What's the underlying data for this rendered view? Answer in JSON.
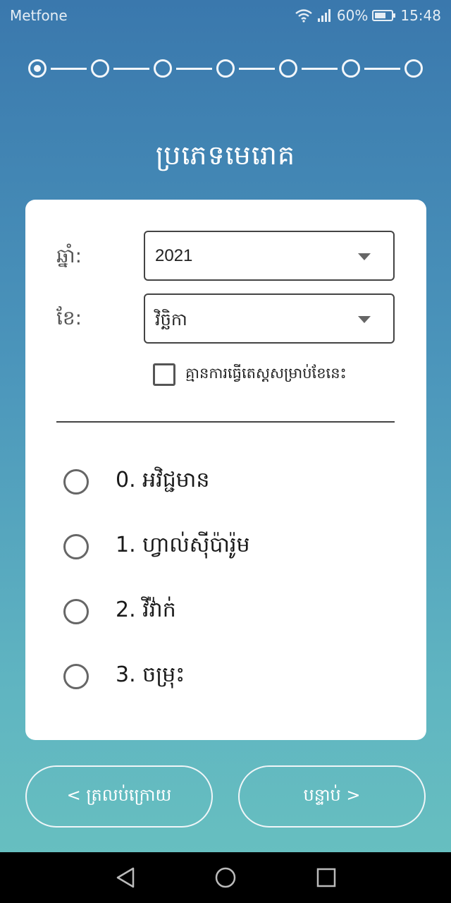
{
  "status_bar": {
    "carrier": "Metfone",
    "battery_percent": "60%",
    "time": "15:48",
    "icons": [
      "wifi-icon",
      "signal-icon",
      "battery-icon"
    ]
  },
  "stepper": {
    "total_steps": 7,
    "current_step": 1
  },
  "page": {
    "title": "ប្រភេទមេរោគ"
  },
  "form": {
    "year": {
      "label": "ឆ្នាំ:",
      "value": "2021"
    },
    "month": {
      "label": "ខែ:",
      "value": "វិច្ឆិកា"
    },
    "no_test_checkbox": {
      "label": "គ្មានការធ្វើតេស្តសម្រាប់ខែនេះ",
      "checked": false
    }
  },
  "options": [
    {
      "label": "0. អវិជ្ជមាន",
      "selected": false
    },
    {
      "label": "1. ហ្វាល់ស៊ីប៉ារ៉ូម",
      "selected": false
    },
    {
      "label": "2. វីវ៉ាក់",
      "selected": false
    },
    {
      "label": "3. ចម្រុះ",
      "selected": false
    }
  ],
  "buttons": {
    "back": "< ត្រលប់ក្រោយ",
    "next": "បន្ទាប់ >"
  },
  "colors": {
    "gradient_top": "#3a78ad",
    "gradient_bottom": "#69c2c0",
    "card": "#ffffff"
  }
}
